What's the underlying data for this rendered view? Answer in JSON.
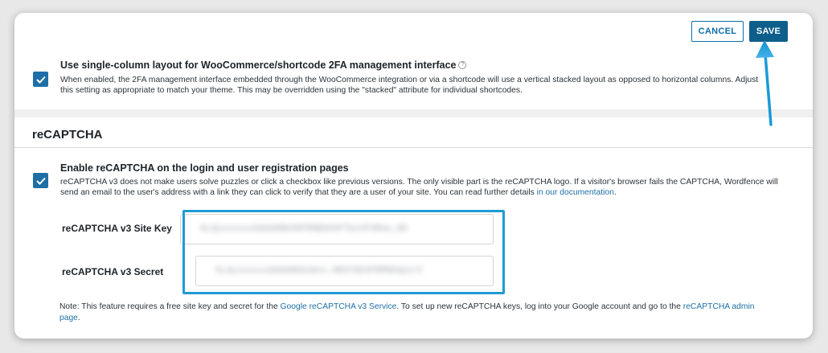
{
  "toolbar": {
    "cancel_label": "CANCEL",
    "save_label": "SAVE"
  },
  "single_column": {
    "checked": true,
    "title": "Use single-column layout for WooCommerce/shortcode 2FA management interface",
    "help_glyph": "?",
    "description": "When enabled, the 2FA management interface embedded through the WooCommerce integration or via a shortcode will use a vertical stacked layout as opposed to horizontal columns. Adjust this setting as appropriate to match your theme. This may be overridden using the \"stacked\" attribute for individual shortcodes."
  },
  "recaptcha": {
    "section_title": "reCAPTCHA",
    "enable": {
      "checked": true,
      "title": "Enable reCAPTCHA on the login and user registration pages",
      "description": "reCAPTCHA v3 does not make users solve puzzles or click a checkbox like previous versions. The only visible part is the reCAPTCHA logo. If a visitor's browser fails the CAPTCHA, Wordfence will send an email to the user's address with a link they can click to verify that they are a user of your site. You can read further details",
      "doc_link": "in our documentation",
      "description_end": "."
    },
    "site_key": {
      "label": "reCAPTCHA v3 Site Key",
      "value": "6LdyxxxxxxAAAAABkHOFRNBSk0FTbzVFSMoe_HD"
    },
    "secret": {
      "label": "reCAPTCHA v3 Secret",
      "value": "6LdyxxxxxxAAAAAEmzWxx-AB3YSE4FRMNDdpsrX"
    },
    "note": {
      "prefix": "Note: This feature requires a free site key and secret for the",
      "service_link": "Google reCAPTCHA v3 Service",
      "middle": ". To set up new reCAPTCHA keys, log into your Google account and go to the",
      "admin_link": "reCAPTCHA admin page",
      "suffix": "."
    }
  },
  "colors": {
    "accent": "#1e6fa6",
    "save_bg": "#0e5e8b",
    "highlight": "#1f9bd6"
  }
}
